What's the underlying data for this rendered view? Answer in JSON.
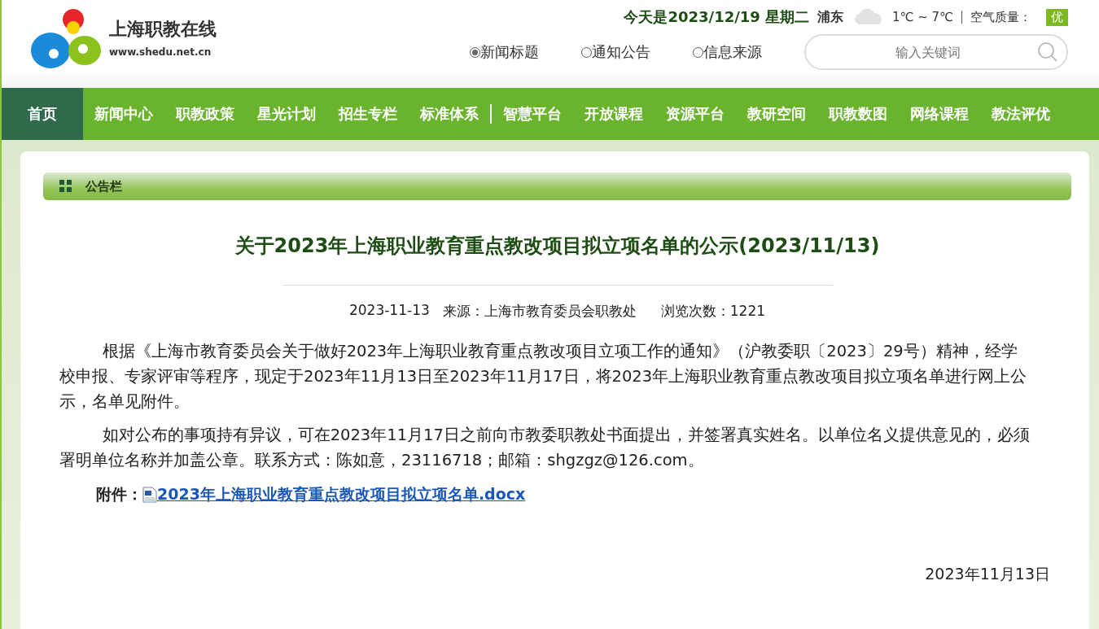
{
  "site": {
    "name": "上海职教在线",
    "url": "www.shedu.net.cn"
  },
  "topbar": {
    "date": "今天是2023/12/19 星期二",
    "district": "浦东",
    "temperature": "1℃ ~ 7℃",
    "air_label": "空气质量：",
    "air_quality": "优"
  },
  "search_scope": [
    {
      "label": "新闻标题",
      "selected": true
    },
    {
      "label": "通知公告",
      "selected": false
    },
    {
      "label": "信息来源",
      "selected": false
    }
  ],
  "search": {
    "placeholder": "输入关键词"
  },
  "nav": [
    {
      "label": "首页",
      "selected": true,
      "divider_after": false
    },
    {
      "label": "新闻中心",
      "selected": false,
      "divider_after": false
    },
    {
      "label": "职教政策",
      "selected": false,
      "divider_after": false
    },
    {
      "label": "星光计划",
      "selected": false,
      "divider_after": false
    },
    {
      "label": "招生专栏",
      "selected": false,
      "divider_after": false
    },
    {
      "label": "标准体系",
      "selected": false,
      "divider_after": true
    },
    {
      "label": "智慧平台",
      "selected": false,
      "divider_after": false
    },
    {
      "label": "开放课程",
      "selected": false,
      "divider_after": false
    },
    {
      "label": "资源平台",
      "selected": false,
      "divider_after": false
    },
    {
      "label": "教研空间",
      "selected": false,
      "divider_after": false
    },
    {
      "label": "职教数图",
      "selected": false,
      "divider_after": false
    },
    {
      "label": "网络课程",
      "selected": false,
      "divider_after": false
    },
    {
      "label": "教法评优",
      "selected": false,
      "divider_after": false
    }
  ],
  "panel_title": "公告栏",
  "article": {
    "title": "关于2023年上海职业教育重点教改项目拟立项名单的公示(2023/11/13)",
    "date": "2023-11-13",
    "source": "来源：上海市教育委员会职教处",
    "views": "浏览次数：1221",
    "paragraphs": [
      "根据《上海市教育委员会关于做好2023年上海职业教育重点教改项目立项工作的通知》（沪教委职〔2023〕29号）精神，经学校申报、专家评审等程序，现定于2023年11月13日至2023年11月17日，将2023年上海职业教育重点教改项目拟立项名单进行网上公示，名单见附件。",
      "如对公布的事项持有异议，可在2023年11月17日之前向市教委职教处书面提出，并签署真实姓名。以单位名义提供意见的，必须署明单位名称并加盖公章。联系方式：陈如意，23116718；邮箱：shgzgz@126.com。"
    ],
    "attachment_label": "附件：",
    "attachment": "2023年上海职业教育重点教改项目拟立项名单.docx",
    "signature_date": "2023年11月13日"
  }
}
